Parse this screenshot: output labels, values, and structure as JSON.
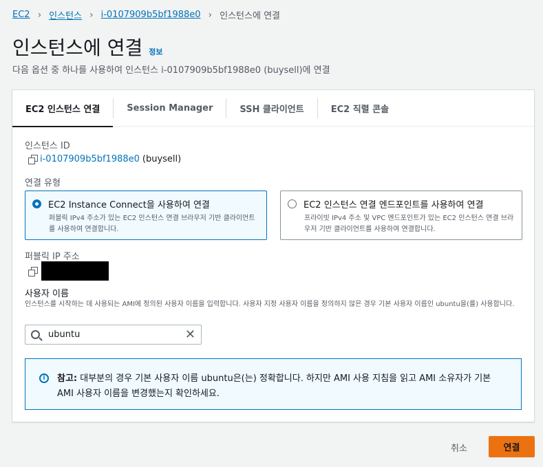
{
  "breadcrumb": {
    "items": [
      "EC2",
      "인스턴스",
      "i-0107909b5bf1988e0"
    ],
    "current": "인스턴스에 연결"
  },
  "header": {
    "title": "인스턴스에 연결",
    "info_link": "정보",
    "subtitle": "다음 옵션 중 하나를 사용하여 인스턴스 i-0107909b5bf1988e0 (buysell)에 연결"
  },
  "tabs": [
    {
      "label": "EC2 인스턴스 연결",
      "active": true
    },
    {
      "label": "Session Manager",
      "active": false
    },
    {
      "label": "SSH 클라이언트",
      "active": false
    },
    {
      "label": "EC2 직렬 콘솔",
      "active": false
    }
  ],
  "instance": {
    "label": "인스턴스 ID",
    "id": "i-0107909b5bf1988e0",
    "name": "(buysell)"
  },
  "connection_type": {
    "label": "연결 유형",
    "options": [
      {
        "title": "EC2 Instance Connect을 사용하여 연결",
        "desc": "퍼블릭 IPv4 주소가 있는 EC2 인스턴스 연결 브라우저 기반 클라이언트를 사용하여 연결합니다.",
        "selected": true
      },
      {
        "title": "EC2 인스턴스 연결 엔드포인트를 사용하여 연결",
        "desc": "프라이빗 IPv4 주소 및 VPC 엔드포인트가 있는 EC2 인스턴스 연결 브라우저 기반 클라이언트를 사용하여 연결합니다.",
        "selected": false
      }
    ]
  },
  "public_ip": {
    "label": "퍼블릭 IP 주소"
  },
  "username": {
    "label": "사용자 이름",
    "description": "인스턴스를 시작하는 데 사용되는 AMI에 정의된 사용자 이름을 입력합니다. 사용자 지정 사용자 이름을 정의하지 않은 경우 기본 사용자 이름인 ubuntu을(를) 사용합니다.",
    "value": "ubuntu"
  },
  "alert": {
    "bold": "참고:",
    "text": " 대부분의 경우 기본 사용자 이름 ubuntu은(는) 정확합니다. 하지만 AMI 사용 지침을 읽고 AMI 소유자가 기본 AMI 사용자 이름을 변경했는지 확인하세요."
  },
  "footer": {
    "cancel_label": "취소",
    "connect_label": "연결"
  },
  "colors": {
    "link": "#0073bb",
    "primary_button": "#ec7211",
    "alert_bg": "#f1faff"
  }
}
